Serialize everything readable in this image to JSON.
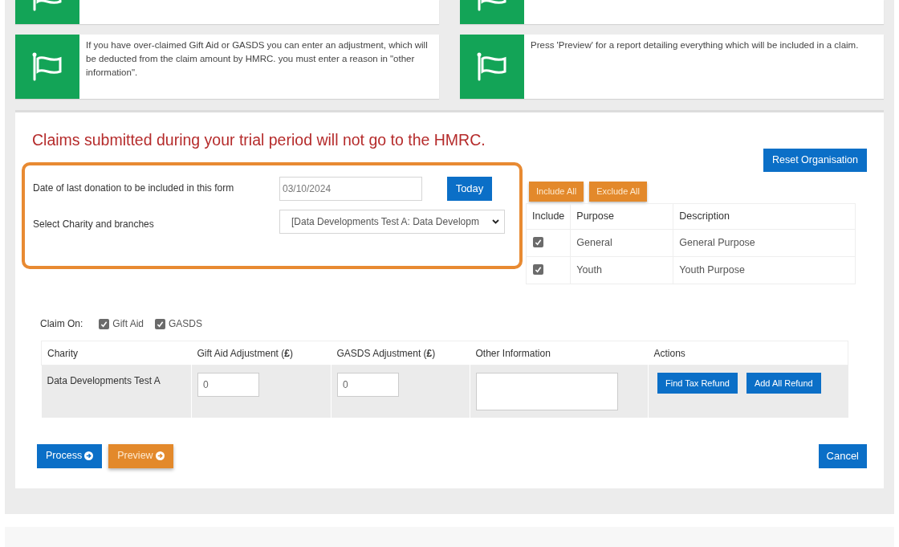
{
  "info_cards": [
    {
      "text": "If you have over-claimed Gift Aid or GASDS you can enter an adjustment, which will be deducted from the claim amount by HMRC. you must enter a reason in \"other information\"."
    },
    {
      "text": "Press 'Preview' for a report detailing everything which will be included in a claim."
    }
  ],
  "warning": "Claims submitted during your trial period will not go to the HMRC.",
  "form": {
    "date_label": "Date of last donation to be included in this form",
    "date_value": "03/10/2024",
    "today_button": "Today",
    "charity_label": "Select Charity and branches",
    "charity_value": "[Data Developments Test A: Data Developm"
  },
  "reset_button": "Reset Organisation",
  "purpose_buttons": [
    "Include All",
    "Exclude All"
  ],
  "purposes": {
    "columns": [
      "Include",
      "Purpose",
      "Description"
    ],
    "rows": [
      {
        "checked": true,
        "purpose": "General",
        "description": "General Purpose"
      },
      {
        "checked": true,
        "purpose": "Youth",
        "description": "Youth Purpose"
      }
    ]
  },
  "claim_on": {
    "label": "Claim On:",
    "options": [
      {
        "label": "Gift Aid",
        "checked": true
      },
      {
        "label": "GASDS",
        "checked": true
      }
    ]
  },
  "claims": {
    "columns": [
      "Charity",
      "Gift Aid Adjustment (**£**)",
      "GASDS Adjustment (**£**)",
      "Other Information",
      "Actions"
    ],
    "rows": [
      {
        "charity": "Data Developments Test A",
        "gift_aid": "0",
        "gasds": "0",
        "other": "",
        "actions": [
          "Find Tax Refund",
          "Add All Refund"
        ]
      }
    ]
  },
  "footer_buttons": [
    {
      "label": "Process",
      "kind": "primary"
    },
    {
      "label": "Preview",
      "kind": "warning"
    }
  ],
  "cancel_button": "Cancel"
}
